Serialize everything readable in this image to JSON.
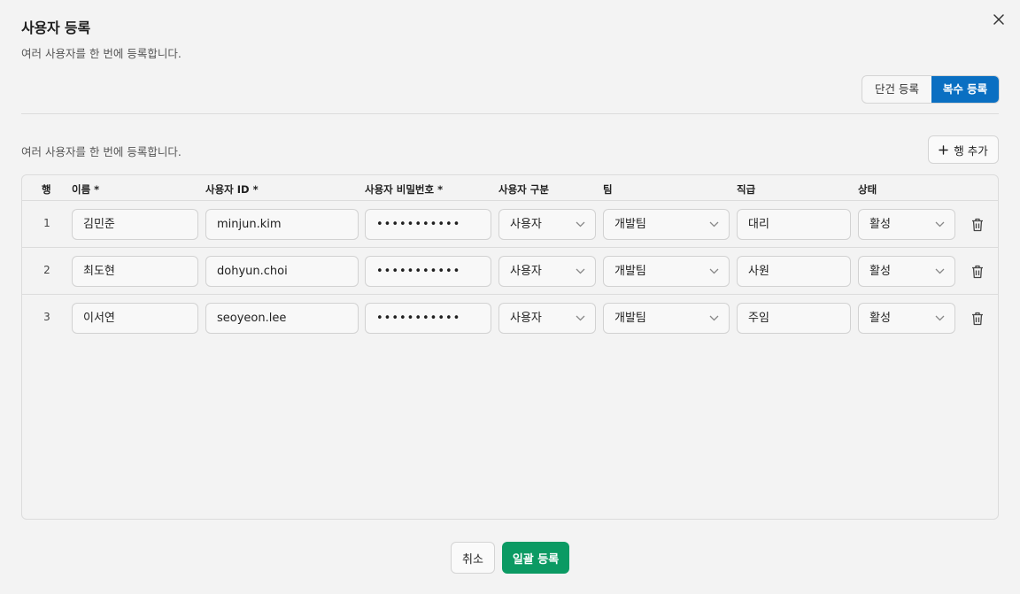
{
  "dialog": {
    "title": "사용자 등록",
    "subtitle": "여러 사용자를 한 번에 등록합니다.",
    "close_icon": "close-icon"
  },
  "mode_toggle": {
    "single_label": "단건 등록",
    "multi_label": "복수 등록",
    "selected": "복수 등록"
  },
  "section": {
    "description": "여러 사용자를 한 번에 등록합니다.",
    "add_row_label": "행 추가"
  },
  "table": {
    "headers": {
      "row": "행",
      "name": "이름 *",
      "user_id": "사용자 ID *",
      "password": "사용자 비밀번호 *",
      "user_type": "사용자 구분",
      "team": "팀",
      "position": "직급",
      "status": "상태"
    },
    "rows": [
      {
        "num": "1",
        "name": "김민준",
        "user_id": "minjun.kim",
        "password": "•••••••••••",
        "user_type": "사용자",
        "team": "개발팀",
        "position": "대리",
        "status": "활성"
      },
      {
        "num": "2",
        "name": "최도현",
        "user_id": "dohyun.choi",
        "password": "•••••••••••",
        "user_type": "사용자",
        "team": "개발팀",
        "position": "사원",
        "status": "활성"
      },
      {
        "num": "3",
        "name": "이서연",
        "user_id": "seoyeon.lee",
        "password": "•••••••••••",
        "user_type": "사용자",
        "team": "개발팀",
        "position": "주임",
        "status": "활성"
      }
    ]
  },
  "footer": {
    "cancel_label": "취소",
    "submit_label": "일괄 등록"
  },
  "colors": {
    "accent_blue": "#0a6fc2",
    "submit_green": "#0b9a63"
  }
}
